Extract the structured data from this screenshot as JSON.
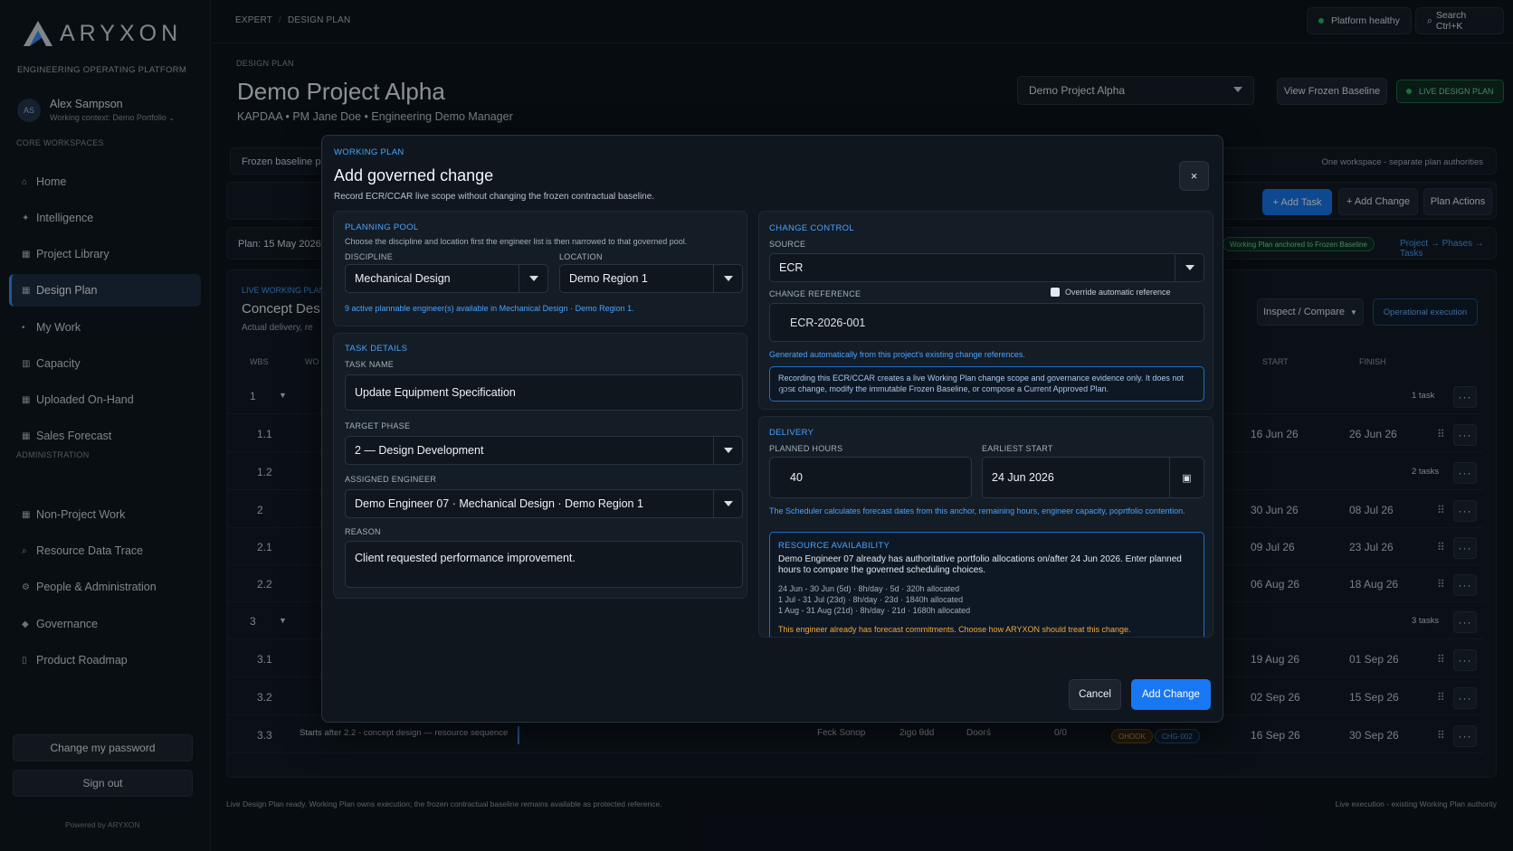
{
  "brand": {
    "name": "ARYXON",
    "tagline": "ENGINEERING OPERATING PLATFORM",
    "powered": "Powered by ARYXON"
  },
  "user": {
    "initials": "AS",
    "name": "Alex Sampson",
    "context": "Working context: Demo Portfolio"
  },
  "sidebar": {
    "core_heading": "CORE WORKSPACES",
    "core_items": [
      {
        "label": "Home",
        "icon": "home-icon"
      },
      {
        "label": "Intelligence",
        "icon": "sparkle-icon"
      },
      {
        "label": "Project Library",
        "icon": "grid-icon"
      },
      {
        "label": "Design Plan",
        "icon": "grid-icon",
        "active": true
      },
      {
        "label": "My Work",
        "icon": "dot-icon"
      },
      {
        "label": "Capacity",
        "icon": "bar-chart-icon"
      },
      {
        "label": "Uploaded On-Hand",
        "icon": "grid-icon"
      },
      {
        "label": "Sales Forecast",
        "icon": "grid-icon"
      }
    ],
    "admin_heading": "ADMINISTRATION",
    "admin_items": [
      {
        "label": "Non-Project Work",
        "icon": "grid-icon"
      },
      {
        "label": "Resource Data Trace",
        "icon": "search-icon"
      },
      {
        "label": "People & Administration",
        "icon": "gear-icon"
      },
      {
        "label": "Governance",
        "icon": "diamond-icon"
      },
      {
        "label": "Product Roadmap",
        "icon": "book-icon"
      }
    ],
    "change_password": "Change my password",
    "sign_out": "Sign out"
  },
  "topbar": {
    "crumb1": "EXPERT",
    "crumb2": "DESIGN PLAN",
    "status": "Platform healthy",
    "search": "Search Ctrl+K"
  },
  "header": {
    "section": "DESIGN PLAN",
    "title": "Demo Project Alpha",
    "meta": "KAPDAA  •  PM Jane Doe  •  Engineering Demo Manager",
    "project_select": "Demo Project Alpha",
    "view_frozen": "View Frozen Baseline",
    "live_badge": "LIVE DESIGN PLAN"
  },
  "workspace": {
    "frozen_text": "Frozen baseline p",
    "separate": "One workspace - separate plan authorities",
    "add_task": "+ Add Task",
    "add_change": "+ Add Change",
    "plan_actions": "Plan Actions",
    "plan_date": "Plan: 15 May 2026",
    "anchored": "Working Plan anchored to Frozen Baseline",
    "flow": "Project → Phases → Tasks",
    "live_label": "LIVE WORKING PLAN",
    "concept_title": "Concept Des",
    "concept_sub": "Actual delivery, re",
    "inspect": "Inspect / Compare",
    "operational": "Operational execution",
    "col_wbs": "WBS",
    "col_wo": "WO",
    "col_start": "START",
    "col_finish": "FINISH"
  },
  "rows": [
    {
      "wbs": "1",
      "group": true,
      "count": "1 task",
      "start": "",
      "finish": ""
    },
    {
      "wbs": "1.1",
      "group": false,
      "count": "",
      "start": "16 Jun 26",
      "finish": "26 Jun 26"
    },
    {
      "wbs": "1.2",
      "group": false,
      "count": "2 tasks",
      "start": "",
      "finish": ""
    },
    {
      "wbs": "2",
      "group": false,
      "count": "",
      "start": "30 Jun 26",
      "finish": "08 Jul 26"
    },
    {
      "wbs": "2.1",
      "group": false,
      "count": "",
      "start": "09 Jul 26",
      "finish": "23 Jul 26"
    },
    {
      "wbs": "2.2",
      "group": false,
      "count": "",
      "start": "06 Aug 26",
      "finish": "18 Aug 26"
    },
    {
      "wbs": "3",
      "group": true,
      "count": "3 tasks",
      "start": "",
      "finish": ""
    },
    {
      "wbs": "3.1",
      "group": false,
      "count": "",
      "start": "19 Aug 26",
      "finish": "01 Sep 26"
    },
    {
      "wbs": "3.2",
      "group": false,
      "count": "",
      "start": "02 Sep 26",
      "finish": "15 Sep 26"
    },
    {
      "wbs": "3.3",
      "group": false,
      "count": "",
      "start": "16 Sep 26",
      "finish": "30 Sep 26"
    }
  ],
  "last_row": {
    "task": "Starts after 2.2 - concept design — resource sequence",
    "eng": "Feck Sonop",
    "hrs": "2ιgo θdd",
    "st": "Dooгś",
    "ratio": "0/0",
    "chip1": "OHOOK",
    "chip2": "CHG-002"
  },
  "footer": {
    "left": "Live Design Plan ready. Working Plan owns execution; the frozen contractual baseline remains available as protected reference.",
    "right": "Live execution - existing Working Plan authority"
  },
  "modal": {
    "kicker": "WORKING PLAN",
    "title": "Add governed change",
    "subtitle": "Record ECR/CCAR live scope without changing the frozen contractual baseline.",
    "close": "×",
    "planning": {
      "heading": "PLANNING POOL",
      "help": "Choose the discipline and location first the engineer list is then narrowed to that governed pool.",
      "discipline_label": "DISCIPLINE",
      "discipline": "Mechanical Design",
      "location_label": "LOCATION",
      "location": "Demo Region 1",
      "available": "9 active plannable engineer(s) available in Mechanical Design · Demo Region 1."
    },
    "task": {
      "heading": "TASK DETAILS",
      "name_label": "TASK NAME",
      "name": "Update Equipment Specification",
      "phase_label": "TARGET PHASE",
      "phase": "2 — Design Development",
      "engineer_label": "ASSIGNED ENGINEER",
      "engineer": "Demo Engineer 07 · Mechanical Design · Demo Region 1",
      "reason_label": "REASON",
      "reason": "Client requested performance improvement."
    },
    "change": {
      "heading": "CHANGE CONTROL",
      "source_label": "SOURCE",
      "source": "ECR",
      "ref_label": "CHANGE REFERENCE",
      "override": "Override automatic reference",
      "ref": "ECR-2026-001",
      "generated": "Generated automatically from this project's existing change references.",
      "info": "Recording this ECR/CCAR creates a live Working Plan change scope and governance evidence only. It does not ദ്ദാടε change, modify the immutable Frozen Baseline, or compose a Current Approved Plan."
    },
    "delivery": {
      "heading": "DELIVERY",
      "hours_label": "PLANNED HOURS",
      "hours": "40",
      "start_label": "EARLIEST START",
      "start": "24 Jun 2026",
      "scheduler": "The Scheduler calculates forecast dates from this anchor, remaining hours, engineer capacity, poprtfolio contention.",
      "ra_heading": "RESOURCE AVAILABILITY",
      "ra_text": "Demo Engineer 07 already has authoritative portfolio allocations on/after 24 Jun 2026. Enter planned hours to compare the governed scheduling choices.",
      "ra_line1": "24 Jun - 30 Jun (5d) · 8h/day · 5d · 320h allocated",
      "ra_line2": "1 Jul - 31 Jul (23d) · 8h/day · 23d · 1840h allocated",
      "ra_line3": "1 Aug - 31 Aug (21d) · 8h/day · 21d · 1680h allocated",
      "ra_warn": "This engineer already has forecast commitments. Choose how ARYXON should treat this change."
    },
    "cancel": "Cancel",
    "submit": "Add Change"
  }
}
